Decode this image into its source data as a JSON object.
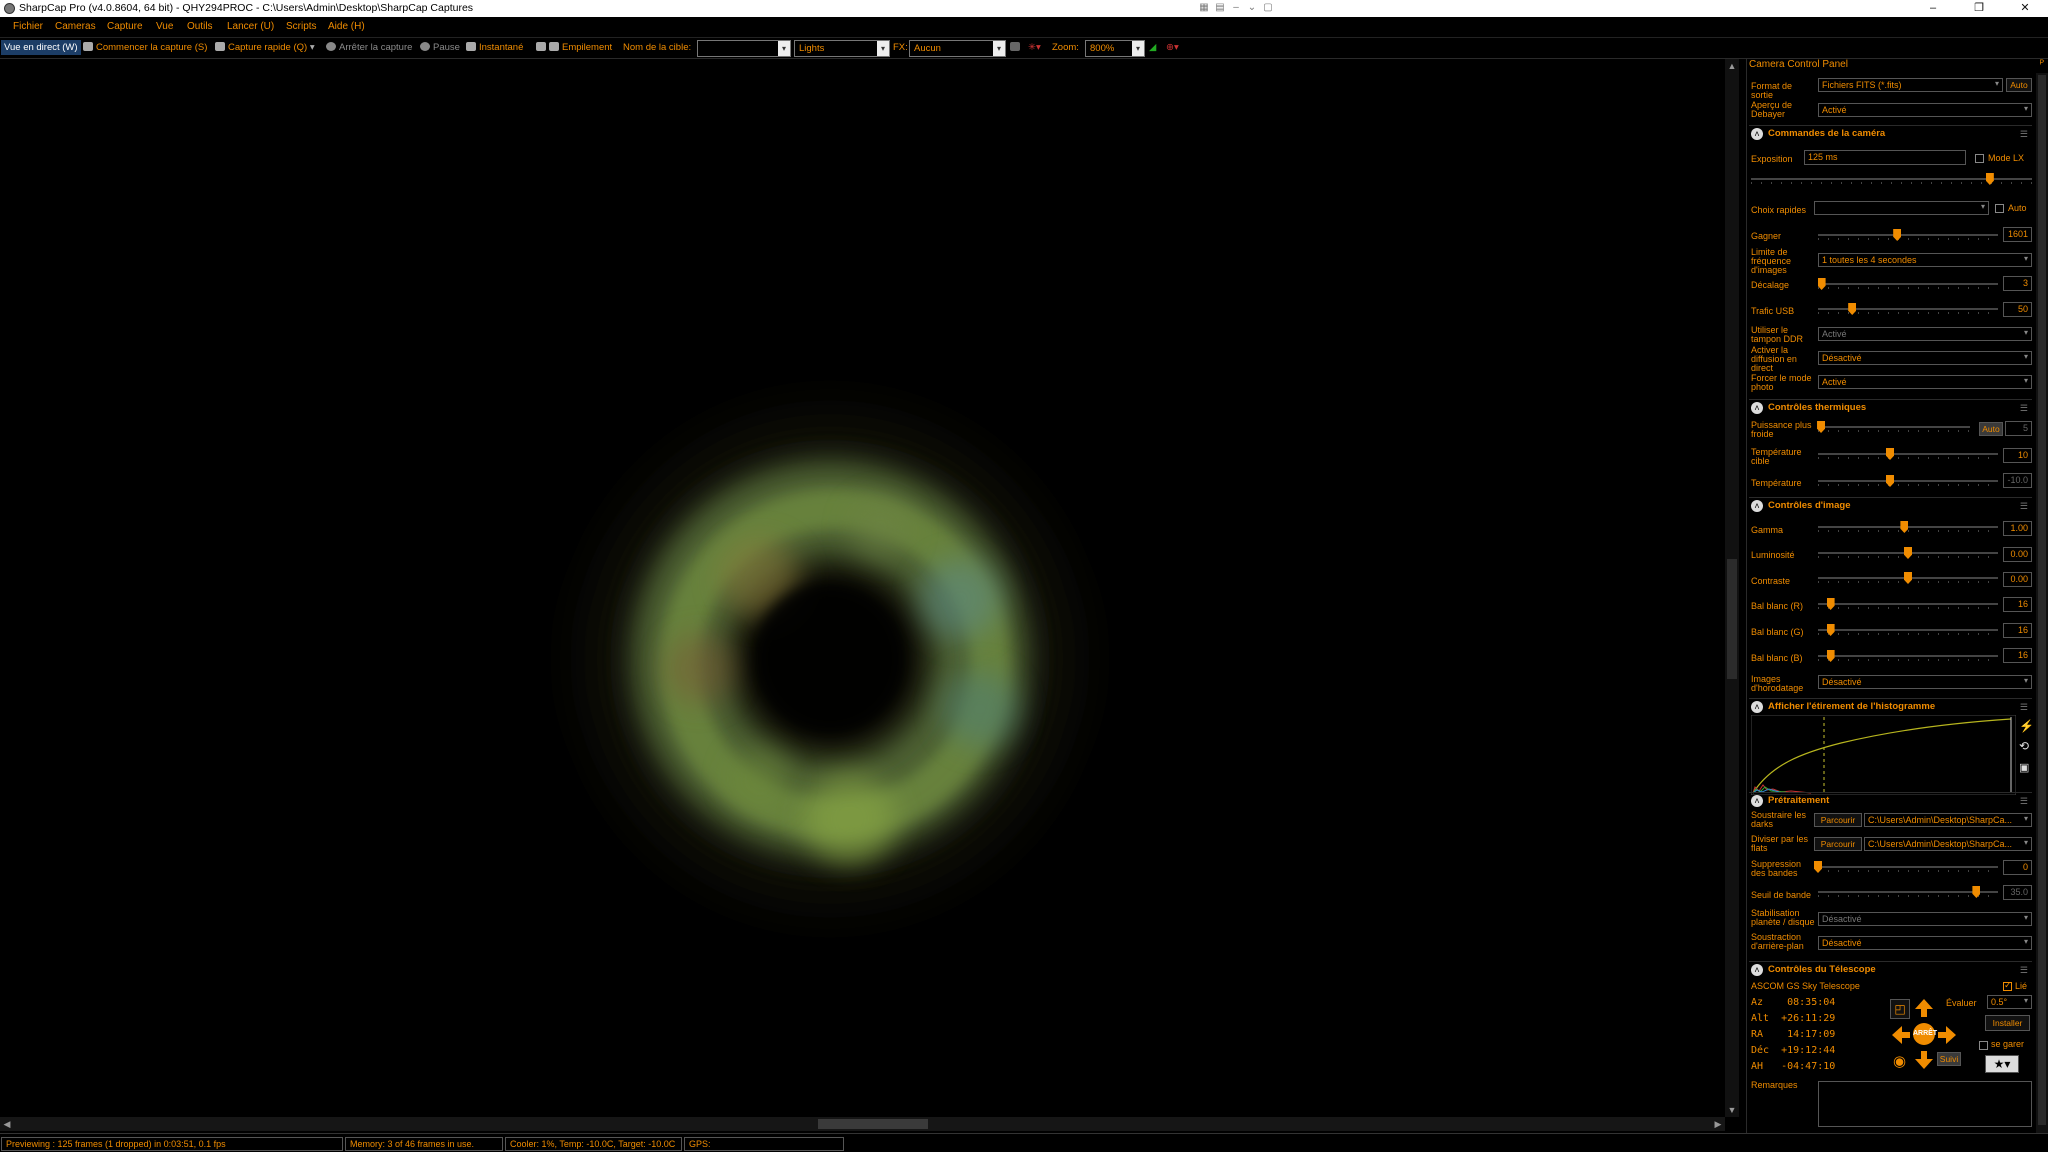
{
  "window": {
    "title": "SharpCap Pro (v4.0.8604, 64 bit) - QHY294PROC - C:\\Users\\Admin\\Desktop\\SharpCap Captures",
    "controls": [
      "–",
      "❐",
      "✕"
    ]
  },
  "menu": [
    "Fichier",
    "Cameras",
    "Capture",
    "Vue",
    "Outils",
    "Lancer (U)",
    "Scripts",
    "Aide (H)"
  ],
  "toolbar": {
    "live_view": "Vue en direct (W)",
    "start_capture": "Commencer la capture (S)",
    "quick_capture": "Capture rapide (Q)",
    "stop_capture": "Arrêter la capture",
    "pause": "Pause",
    "snapshot": "Instantané",
    "stacking": "Empilement",
    "target_label": "Nom de la cible:",
    "target_value": "",
    "frame_type": "Lights",
    "fx_label": "FX:",
    "fx_value": "Aucun",
    "zoom_label": "Zoom:",
    "zoom_value": "800%"
  },
  "panel": {
    "title": "Camera Control Panel",
    "pin": "ᴾ",
    "output_format_label": "Format de sortie",
    "output_format_value": "Fichiers FITS (*.fits)",
    "output_auto": "Auto",
    "debayer_label": "Aperçu de Debayer",
    "debayer_value": "Activé",
    "camera_section": "Commandes de la caméra",
    "exposure_label": "Exposition",
    "exposure_value": "125 ms",
    "exposure_slider": 0.85,
    "lx_mode": "Mode LX",
    "quick_picks_label": "Choix rapides",
    "quick_picks_value": "",
    "quick_auto": "Auto",
    "gain_label": "Gagner",
    "gain_value": "1601",
    "gain_slider": 0.44,
    "framerate_label": "Limite de fréquence d'images",
    "framerate_value": "1 toutes les 4 secondes",
    "offset_label": "Décalage",
    "offset_value": "3",
    "offset_slider": 0.02,
    "usb_label": "Trafic USB",
    "usb_value": "50",
    "usb_slider": 0.19,
    "ddr_label": "Utiliser le tampon DDR",
    "ddr_value": "Activé",
    "streaming_label": "Activer la diffusion en direct",
    "streaming_value": "Désactivé",
    "photo_mode_label": "Forcer le mode photo",
    "photo_mode_value": "Activé",
    "thermal_section": "Contrôles thermiques",
    "cooler_power_label": "Puissance plus froide",
    "cooler_power_value": "5",
    "cooler_auto": "Auto",
    "cooler_power_slider": 0.02,
    "target_temp_label": "Température cible",
    "target_temp_value": "10",
    "target_temp_slider": 0.4,
    "temp_label": "Température",
    "temp_value": "-10.0",
    "temp_slider": 0.4,
    "image_section": "Contrôles d'image",
    "gamma_label": "Gamma",
    "gamma_value": "1.00",
    "gamma_slider": 0.48,
    "brightness_label": "Luminosité",
    "brightness_value": "0.00",
    "brightness_slider": 0.5,
    "contrast_label": "Contraste",
    "contrast_value": "0.00",
    "contrast_slider": 0.5,
    "wb_r_label": "Bal blanc (R)",
    "wb_r_value": "16",
    "wb_r_slider": 0.07,
    "wb_g_label": "Bal blanc (G)",
    "wb_g_value": "16",
    "wb_g_slider": 0.07,
    "wb_b_label": "Bal blanc (B)",
    "wb_b_value": "16",
    "wb_b_slider": 0.07,
    "timestamp_label": "Images d'horodatage",
    "timestamp_value": "Désactivé",
    "histogram_section": "Afficher l'étirement de l'histogramme",
    "preprocess_section": "Prétraitement",
    "darks_label": "Soustraire les darks",
    "darks_browse": "Parcourir",
    "darks_path": "C:\\Users\\Admin\\Desktop\\SharpCa...",
    "flats_label": "Diviser par les flats",
    "flats_browse": "Parcourir",
    "flats_path": "C:\\Users\\Admin\\Desktop\\SharpCa...",
    "banding_label": "Suppression des bandes",
    "banding_value": "0",
    "banding_slider": 0.0,
    "band_threshold_label": "Seuil de bande",
    "band_threshold_value": "35.0",
    "band_threshold_slider": 0.88,
    "stabilization_label": "Stabilisation planète / disque",
    "stabilization_value": "Désactivé",
    "bg_sub_label": "Soustraction d'arrière-plan",
    "bg_sub_value": "Désactivé",
    "telescope_section": "Contrôles du Télescope",
    "telescope_name": "ASCOM GS Sky Telescope",
    "telescope_linked": "Lié",
    "az": "Az    08:35:04",
    "alt": "Alt  +26:11:29",
    "ra": "RA    14:17:09",
    "dec": "Déc  +19:12:44",
    "ah": "AH   -04:47:10",
    "rate_label": "Évaluer",
    "rate_value": "0.5°",
    "install": "Installer",
    "stop": "ARRÊT",
    "park": "se garer",
    "follow": "Suivi",
    "notes_label": "Remarques"
  },
  "status": {
    "preview": "Previewing : 125 frames (1 dropped) in 0:03:51, 0.1 fps",
    "memory": "Memory: 3 of 46 frames in use.",
    "cooler": "Cooler: 1%, Temp: -10.0C, Target: -10.0C",
    "gps": "GPS:"
  },
  "colors": {
    "accent": "#f08c00",
    "background": "#000000",
    "live_view_bg": "#1c3d66"
  }
}
